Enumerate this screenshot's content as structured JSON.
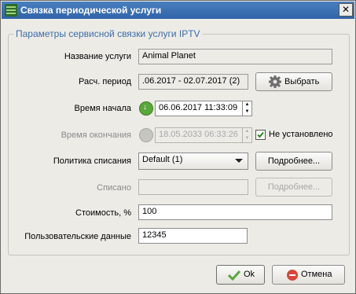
{
  "window": {
    "title": "Связка периодической услуги",
    "close_symbol": "✕"
  },
  "group": {
    "title": "Параметры сервисной связки услуги IPTV"
  },
  "fields": {
    "service_name": {
      "label": "Название услуги",
      "value": "Animal Planet"
    },
    "period": {
      "label": "Расч. период",
      "value": ".06.2017 - 02.07.2017 (2)",
      "button": "Выбрать"
    },
    "start_time": {
      "label": "Время начала",
      "value": "06.06.2017 11:33:09"
    },
    "end_time": {
      "label": "Время окончания",
      "value": "18.05.2033 06:33:26",
      "checkbox_label": "Не установлено",
      "checked": true
    },
    "write_off_policy": {
      "label": "Политика списания",
      "value": "Default (1)",
      "button": "Подробнее..."
    },
    "written_off": {
      "label": "Списано",
      "value": "",
      "button": "Подробнее..."
    },
    "cost": {
      "label": "Стоимость, %",
      "value": "100"
    },
    "user_data": {
      "label": "Пользовательские данные",
      "value": "12345"
    }
  },
  "buttons": {
    "ok": "Ok",
    "cancel": "Отмена"
  },
  "colors": {
    "accent": "#3c6ea8",
    "title_bar": "#2f64a8",
    "ok_green": "#5aa83a",
    "cancel_red": "#d8453b"
  }
}
